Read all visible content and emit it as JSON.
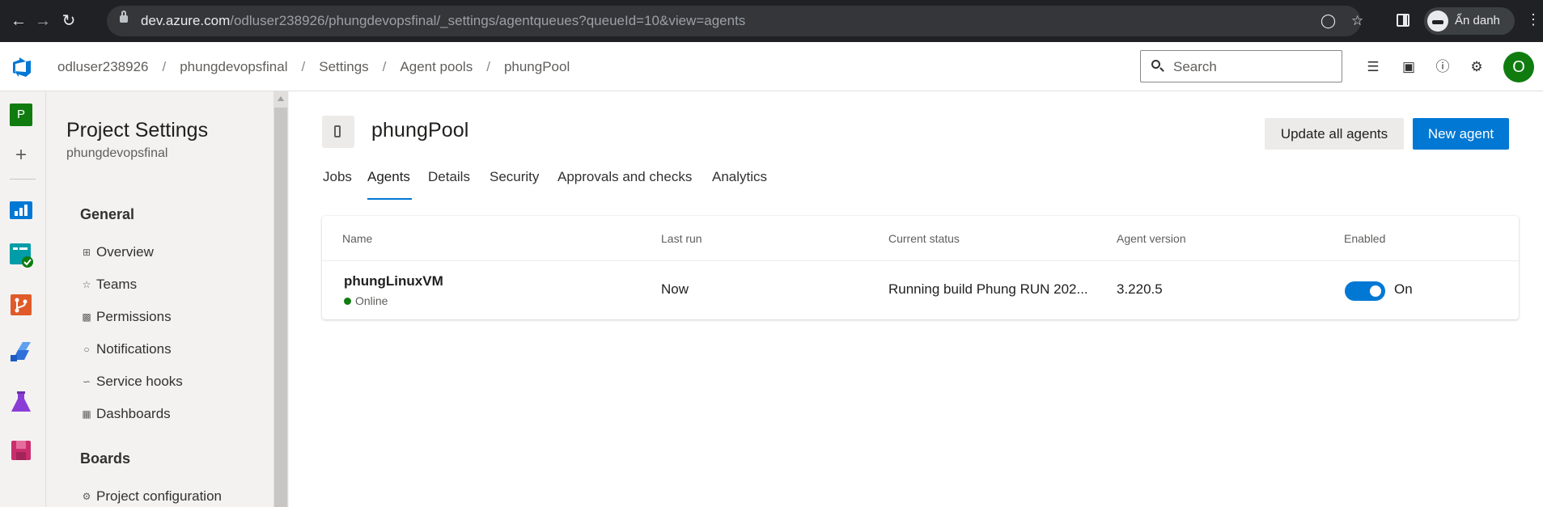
{
  "browser": {
    "url_host": "dev.azure.com",
    "url_path": "/odluser238926/phungdevopsfinal/_settings/agentqueues?queueId=10&view=agents",
    "profile_label": "Ẩn danh"
  },
  "header": {
    "breadcrumbs": [
      "odluser238926",
      "phungdevopsfinal",
      "Settings",
      "Agent pools",
      "phungPool"
    ],
    "search_placeholder": "Search",
    "avatar_initial": "O"
  },
  "rail": {
    "project_initial": "P",
    "add_symbol": "+"
  },
  "settings_nav": {
    "title": "Project Settings",
    "subtitle": "phungdevopsfinal",
    "groups": [
      {
        "label": "General",
        "items": [
          {
            "label": "Overview",
            "icon": "overview-icon"
          },
          {
            "label": "Teams",
            "icon": "teams-icon"
          },
          {
            "label": "Permissions",
            "icon": "lock-icon"
          },
          {
            "label": "Notifications",
            "icon": "notification-icon"
          },
          {
            "label": "Service hooks",
            "icon": "service-hooks-icon"
          },
          {
            "label": "Dashboards",
            "icon": "dashboard-icon"
          }
        ]
      },
      {
        "label": "Boards",
        "items": [
          {
            "label": "Project configuration",
            "icon": "project-config-icon"
          }
        ]
      }
    ]
  },
  "main": {
    "pool_name": "phungPool",
    "buttons": {
      "update_all": "Update all agents",
      "new_agent": "New agent"
    },
    "tabs": [
      "Jobs",
      "Agents",
      "Details",
      "Security",
      "Approvals and checks",
      "Analytics"
    ],
    "active_tab": "Agents",
    "table": {
      "columns": [
        "Name",
        "Last run",
        "Current status",
        "Agent version",
        "Enabled"
      ],
      "rows": [
        {
          "name": "phungLinuxVM",
          "status": "Online",
          "last_run": "Now",
          "current_status": "Running build Phung RUN 202...",
          "agent_version": "3.220.5",
          "enabled": true,
          "enabled_label": "On"
        }
      ]
    }
  },
  "colors": {
    "accent": "#0078d4",
    "online": "#107c10",
    "avatar": "#107c10"
  }
}
